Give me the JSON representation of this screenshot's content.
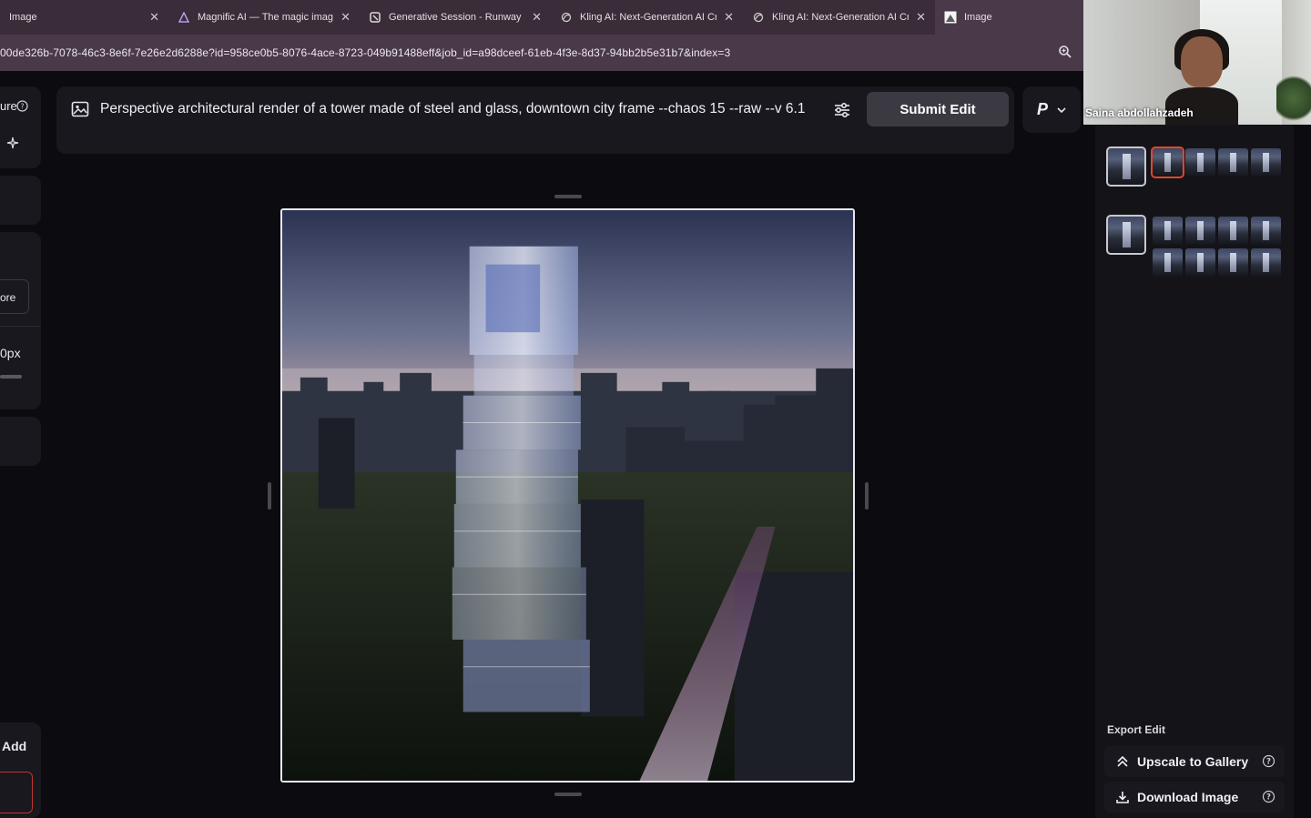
{
  "tabs": [
    {
      "label": "Image",
      "icon": "none",
      "active": false
    },
    {
      "label": "Magnific AI — The magic imag",
      "icon": "magnific-triangle-icon",
      "active": false
    },
    {
      "label": "Generative Session - Runway",
      "icon": "runway-icon",
      "active": false
    },
    {
      "label": "Kling AI: Next-Generation AI Cr",
      "icon": "kling-icon",
      "active": false
    },
    {
      "label": "Kling AI: Next-Generation AI Cr",
      "icon": "kling-icon",
      "active": false
    },
    {
      "label": "Image",
      "icon": "image-tab-icon",
      "active": true
    }
  ],
  "address": {
    "url": "00de326b-7078-46c3-8e6f-7e26e2d6288e?id=958ce0b5-8076-4ace-8723-049b91488eff&job_id=a98dceef-61eb-4f3e-8d37-94bb2b5e31b7&index=3"
  },
  "left_sidebar": {
    "texture_label": "ure",
    "explore_label": "ore",
    "size_label": "0px",
    "add_label": "Add"
  },
  "prompt": {
    "text": "Perspective architectural render of a tower made of steel and glass, downtown city frame --chaos 15 --raw --v 6.1",
    "submit_label": "Submit Edit"
  },
  "model_select": {
    "value": "P"
  },
  "webcam": {
    "name": "Saina abdollahzadeh"
  },
  "right_panel": {
    "export_label": "Export Edit",
    "upscale_label": "Upscale to Gallery",
    "download_label": "Download Image"
  },
  "colors": {
    "tab_bar": "#3a2c38",
    "address_bar": "#4a3a49",
    "background": "#0c0b10",
    "panel": "#19181e",
    "selected_thumb": "#e2452c"
  }
}
